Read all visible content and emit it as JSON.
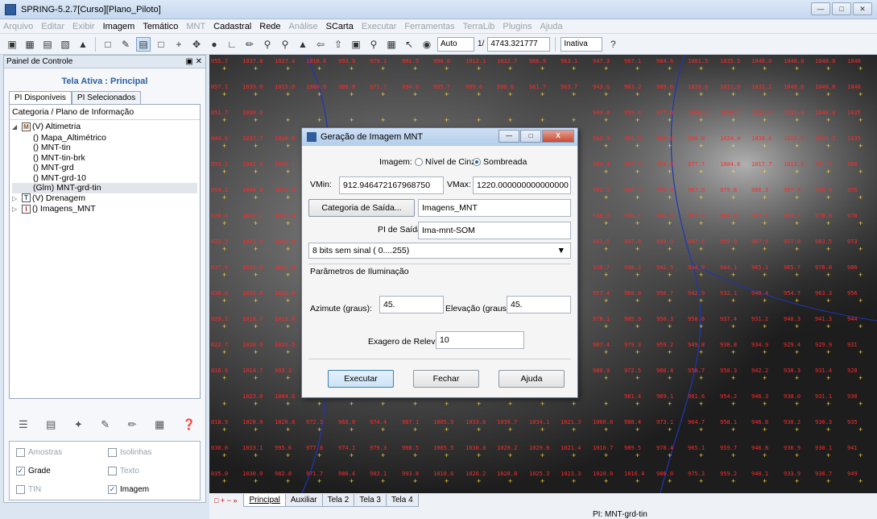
{
  "window": {
    "title": "SPRING-5.2.7[Curso][Plano_Piloto]"
  },
  "menu": [
    {
      "label": "Arquivo",
      "enabled": false
    },
    {
      "label": "Editar",
      "enabled": false
    },
    {
      "label": "Exibir",
      "enabled": false
    },
    {
      "label": "Imagem",
      "enabled": true
    },
    {
      "label": "Temático",
      "enabled": true
    },
    {
      "label": "MNT",
      "enabled": false
    },
    {
      "label": "Cadastral",
      "enabled": true
    },
    {
      "label": "Rede",
      "enabled": true
    },
    {
      "label": "Análise",
      "enabled": false
    },
    {
      "label": "SCarta",
      "enabled": true
    },
    {
      "label": "Executar",
      "enabled": false
    },
    {
      "label": "Ferramentas",
      "enabled": false
    },
    {
      "label": "TerraLib",
      "enabled": false
    },
    {
      "label": "Plugins",
      "enabled": false
    },
    {
      "label": "Ajuda",
      "enabled": false
    }
  ],
  "toolbar": {
    "zoom_mode": "Auto",
    "scale_prefix": "1/",
    "scale_value": "4743.321777",
    "state": "Inativa"
  },
  "panel": {
    "title": "Painel de Controle",
    "active_label": "Tela Ativa : Principal",
    "tabs": [
      "PI Disponíveis",
      "PI Selecionados"
    ],
    "tree_header": "Categoria / Plano de Informação",
    "tree": [
      {
        "label": "(V) Altimetria",
        "cat": "M"
      },
      {
        "label": "() Mapa_Altimétrico"
      },
      {
        "label": "() MNT-tin"
      },
      {
        "label": "() MNT-tin-brk"
      },
      {
        "label": "() MNT-grd"
      },
      {
        "label": "() MNT-grd-10"
      },
      {
        "label": "(Glm) MNT-grd-tin"
      },
      {
        "label": "(V) Drenagem",
        "cat": "T"
      },
      {
        "label": "() Imagens_MNT",
        "cat": "I"
      }
    ],
    "checkboxes": {
      "amostras": "Amostras",
      "isolinhas": "Isolinhas",
      "grade": "Grade",
      "texto": "Texto",
      "tin": "TIN",
      "imagem": "Imagem"
    }
  },
  "canvas": {
    "grid_rows": [
      [
        "055.7",
        "1037.8",
        "1027.4",
        "1016.6",
        "993.9",
        "979.1",
        "981.5",
        "990.0",
        "1012.1",
        "1032.7",
        "966.9",
        "963.1",
        "947.3",
        "967.1",
        "984.6",
        "1001.5",
        "1035.5",
        "1040.0",
        "1040.0",
        "1040.0",
        "1040"
      ],
      [
        "057.1",
        "1039.0",
        "1015.0",
        "1000.0",
        "980.8",
        "971.7",
        "994.0",
        "995.7",
        "999.6",
        "990.6",
        "961.7",
        "963.7",
        "943.6",
        "963.2",
        "989.6",
        "1026.6",
        "1031.8",
        "1032.2",
        "1040.0",
        "1040.0",
        "1040"
      ],
      [
        "051.7",
        "1039.4",
        "",
        "",
        "",
        "",
        "",
        "",
        "",
        "",
        "",
        "",
        "944.8",
        "959.4",
        "977.0",
        "1006.6",
        "1026.7",
        "1031.4",
        "1031.4",
        "1040.0",
        "1035"
      ],
      [
        "044.6",
        "1037.7",
        "1030.0",
        "",
        "",
        "",
        "",
        "",
        "",
        "",
        "",
        "",
        "945.9",
        "955.0",
        "969.0",
        "990.0",
        "1024.4",
        "1038.6",
        "1012.5",
        "1024.2",
        "1035"
      ],
      [
        "059.1",
        "1042.4",
        "1036.1",
        "",
        "",
        "",
        "",
        "",
        "",
        "",
        "",
        "",
        "943.4",
        "946.5",
        "958.8",
        "977.7",
        "1004.6",
        "1017.7",
        "1012.6",
        "991.2",
        "988"
      ],
      [
        "054.2",
        "1044.8",
        "1033.0",
        "",
        "",
        "",
        "",
        "",
        "",
        "",
        "",
        "",
        "942.2",
        "945.7",
        "956.9",
        "967.0",
        "979.8",
        "986.3",
        "987.8",
        "976.9",
        "976"
      ],
      [
        "036.8",
        "1026.1",
        "1028.0",
        "",
        "",
        "",
        "",
        "",
        "",
        "",
        "",
        "",
        "938.0",
        "938.7",
        "949.9",
        "957.6",
        "964.8",
        "977.5",
        "989.7",
        "978.0",
        "978"
      ],
      [
        "032.3",
        "1012.5",
        "1022.0",
        "",
        "",
        "",
        "",
        "",
        "",
        "",
        "",
        "",
        "941.5",
        "937.4",
        "939.1",
        "947.6",
        "959.9",
        "967.5",
        "977.0",
        "983.5",
        "973"
      ],
      [
        "037.8",
        "1030.0",
        "1027.0",
        "",
        "",
        "",
        "",
        "",
        "",
        "",
        "",
        "",
        "935.7",
        "948.2",
        "942.5",
        "934.9",
        "944.1",
        "965.1",
        "965.7",
        "978.6",
        "986"
      ],
      [
        "036.0",
        "1030.0",
        "1020.0",
        "",
        "",
        "",
        "",
        "",
        "",
        "",
        "",
        "",
        "957.4",
        "960.0",
        "950.7",
        "942.9",
        "932.1",
        "940.4",
        "954.7",
        "963.3",
        "956"
      ],
      [
        "029.1",
        "1018.7",
        "1010.0",
        "",
        "",
        "",
        "",
        "",
        "",
        "",
        "",
        "",
        "978.1",
        "985.9",
        "958.3",
        "950.0",
        "937.4",
        "931.2",
        "940.3",
        "941.3",
        "944"
      ],
      [
        "022.7",
        "1020.0",
        "1015.0",
        "",
        "",
        "",
        "",
        "",
        "",
        "",
        "",
        "",
        "987.4",
        "979.3",
        "959.2",
        "949.8",
        "938.8",
        "934.9",
        "929.4",
        "929.9",
        "931"
      ],
      [
        "016.9",
        "1014.7",
        "993.3",
        "",
        "",
        "",
        "",
        "",
        "",
        "",
        "",
        "",
        "980.9",
        "972.5",
        "960.4",
        "958.7",
        "950.3",
        "942.2",
        "938.3",
        "931.4",
        "928"
      ],
      [
        "",
        "1023.0",
        "1004.6",
        "",
        "",
        "",
        "",
        "",
        "",
        "",
        "",
        "",
        "",
        "981.4",
        "969.1",
        "961.6",
        "954.2",
        "946.3",
        "938.0",
        "931.1",
        "930"
      ],
      [
        "018.9",
        "1028.0",
        "1026.0",
        "972.3",
        "968.0",
        "974.4",
        "987.1",
        "1005.9",
        "1033.6",
        "1038.7",
        "1034.1",
        "1021.3",
        "1000.0",
        "988.4",
        "973.1",
        "964.7",
        "958.1",
        "946.8",
        "938.2",
        "930.3",
        "935"
      ],
      [
        "030.0",
        "1033.1",
        "995.6",
        "977.8",
        "974.1",
        "979.3",
        "988.5",
        "1005.5",
        "1030.0",
        "1028.2",
        "1029.0",
        "1021.4",
        "1010.7",
        "989.5",
        "978.4",
        "965.1",
        "959.7",
        "946.8",
        "936.9",
        "930.1",
        "941"
      ],
      [
        "035.0",
        "1030.0",
        "982.8",
        "971.7",
        "980.4",
        "983.1",
        "993.8",
        "1010.6",
        "1026.2",
        "1028.8",
        "1025.3",
        "1023.3",
        "1020.0",
        "1016.4",
        "986.0",
        "975.3",
        "959.2",
        "940.1",
        "933.9",
        "938.7",
        "949"
      ]
    ]
  },
  "dialog": {
    "title": "Geração de Imagem MNT",
    "imagem_label": "Imagem:",
    "radio_nivel": "Nível de Cinza",
    "radio_sombreada": "Sombreada",
    "vmin_label": "VMin:",
    "vmin_value": "912.946472167968750",
    "vmax_label": "VMax:",
    "vmax_value": "1220.000000000000000",
    "categoria_button": "Categoria de Saída...",
    "categoria_value": "Imagens_MNT",
    "pi_saida_label": "PI de Saída:",
    "pi_saida_value": "Ima-mnt-SOM",
    "bits_select": "8 bits sem sinal ( 0....255)",
    "iluminacao_label": "Parâmetros de Iluminação",
    "azimute_label": "Azimute (graus):",
    "azimute_value": "45.",
    "elevacao_label": "Elevação (graus):",
    "elevacao_value": "45.",
    "exagero_label": "Exagero de Relevo:",
    "exagero_value": "10",
    "executar": "Executar",
    "fechar": "Fechar",
    "ajuda": "Ajuda"
  },
  "status": {
    "tabs": [
      "Principal",
      "Auxiliar",
      "Tela 2",
      "Tela 3",
      "Tela 4"
    ],
    "pi": "PI: MNT-grd-tin"
  }
}
